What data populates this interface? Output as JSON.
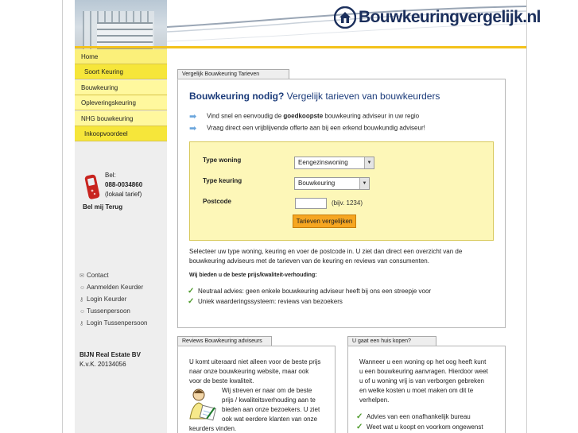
{
  "header": {
    "logo_text": "Bouwkeuringvergelijk.nl",
    "logo_icon": "house-icon"
  },
  "sidebar": {
    "nav": [
      {
        "label": "Home"
      },
      {
        "label": "Soort Keuring"
      },
      {
        "label": "Bouwkeuring"
      },
      {
        "label": "Opleveringskeuring"
      },
      {
        "label": "NHG bouwkeuring"
      },
      {
        "label": "Inkoopvoordeel"
      }
    ],
    "phone": {
      "bel": "Bel:",
      "number": "088-0034860",
      "tarief": "(lokaal tarief)",
      "bel_mij": "Bel mij Terug"
    },
    "links": [
      {
        "label": "Contact",
        "icon": "envelope-icon"
      },
      {
        "label": "Aanmelden Keurder",
        "icon": "user-icon"
      },
      {
        "label": "Login Keurder",
        "icon": "key-icon"
      },
      {
        "label": "Tussenpersoon",
        "icon": "user-icon"
      },
      {
        "label": "Login Tussenpersoon",
        "icon": "key-icon"
      }
    ],
    "company": {
      "name": "BIJN Real Estate BV",
      "kvk": "K.v.K. 20134056"
    }
  },
  "main": {
    "tab": "Vergelijk Bouwkeuring Tarieven",
    "title_bold": "Bouwkeuring nodig?",
    "title_rest": " Vergelijk tarieven van bouwkeurders",
    "bullet1_pre": "Vind snel en eenvoudig de ",
    "bullet1_bold": "goedkoopste",
    "bullet1_post": " bouwkeuring adviseur in uw regio",
    "bullet2": "Vraag direct een vrijblijvende offerte aan bij een erkend bouwkundig adviseur!",
    "form": {
      "type_woning_label": "Type woning",
      "type_woning_value": "Eengezinswoning",
      "type_keuring_label": "Type keuring",
      "type_keuring_value": "Bouwkeuring",
      "postcode_label": "Postcode",
      "postcode_value": "",
      "postcode_hint": "(bijv. 1234)",
      "submit": "Tarieven vergelijken"
    },
    "intro1": "Selecteer uw type woning, keuring en voer de postcode in. U ziet dan direct een overzicht van de",
    "intro2": "bouwkeuring adviseurs met de tarieven van de keuring en reviews van consumenten.",
    "best_heading": "Wij bieden u de beste prijs/kwaliteit-verhouding:",
    "checks": [
      "Neutraal advies: geen enkele bouwkeuring adviseur heeft bij ons een streepje voor",
      "Uniek waarderingssysteem: reviews van bezoekers"
    ]
  },
  "reviews": {
    "tab": "Reviews Bouwkeuring adviseurs",
    "lines": [
      "U komt uiteraard niet alleen voor de beste prijs",
      "naar onze bouwkeuring website, maar ook",
      "voor de beste kwaliteit."
    ],
    "lines2": [
      "Wij streven er naar om de beste",
      "prijs / kwaliteitsverhouding aan te",
      "bieden aan onze bezoekers. U ziet",
      "ook wat eerdere klanten van onze"
    ],
    "last": "keurders vinden."
  },
  "huis": {
    "tab": "U gaat een huis kopen?",
    "lines": [
      "Wanneer u een woning op het oog heeft kunt",
      "u een bouwkeuring aanvragen. Hierdoor weet",
      "u of u woning vrij is van verborgen gebreken",
      "en welke kosten u moet maken om dit te",
      "verhelpen."
    ],
    "checks": [
      "Advies van een onafhankelijk bureau",
      "Weet wat u koopt en voorkom ongewenst"
    ]
  },
  "colors": {
    "nav_yellow": "#fbf07a",
    "accent_yellow": "#f3c21b",
    "form_bg": "#fdf7b8",
    "button_orange": "#f6a620",
    "title_blue": "#1b3b7a"
  }
}
